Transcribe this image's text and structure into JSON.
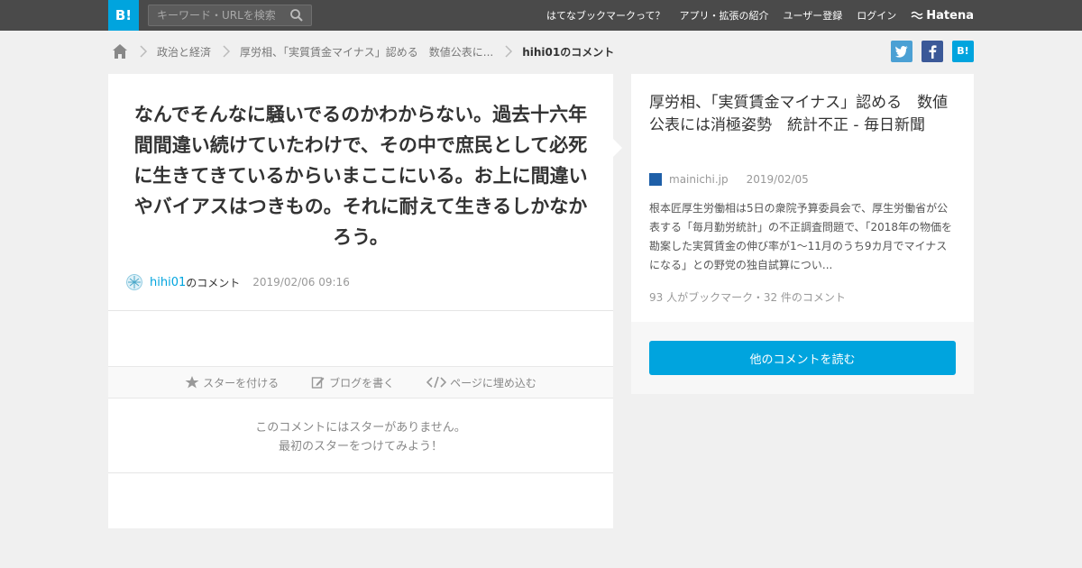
{
  "header": {
    "logo": "B!",
    "search_placeholder": "キーワード・URLを検索",
    "links": [
      "はてなブックマークって？",
      "アプリ・拡張の紹介",
      "ユーザー登録",
      "ログイン"
    ],
    "brand": "Hatena"
  },
  "breadcrumb": {
    "items": [
      "政治と経済",
      "厚労相、「実質賃金マイナス」認める　数値公表に...",
      "hihi01のコメント"
    ]
  },
  "share": {
    "twitter": "t",
    "facebook": "f",
    "hatena": "B!"
  },
  "comment": {
    "text": "なんでそんなに騒いでるのかわからない。過去十六年間間違い続けていたわけで、その中で庶民として必死に生きてきているからいまここにいる。お上に間違いやバイアスはつきもの。それに耐えて生きるしかなかろう。",
    "user": "hihi01",
    "suffix": "のコメント",
    "date": "2019/02/06 09:16",
    "actions": {
      "star": "スターを付ける",
      "blog": "ブログを書く",
      "embed": "ページに埋め込む"
    },
    "no_star_line1": "このコメントにはスターがありません。",
    "no_star_line2": "最初のスターをつけてみよう！"
  },
  "entry": {
    "title": "厚労相、「実質賃金マイナス」認める　数値公表には消極姿勢　統計不正 - 毎日新聞",
    "domain": "mainichi.jp",
    "date": "2019/02/05",
    "summary": "根本匠厚生労働相は5日の衆院予算委員会で、厚生労働省が公表する「毎月勤労統計」の不正調査問題で、「2018年の物価を勘案した実質賃金の伸び率が1～11月のうち9カ月でマイナスになる」との野党の独自試算につい...",
    "counts": "93 人がブックマーク・32 件のコメント",
    "read_more": "他のコメントを読む"
  },
  "colors": {
    "accent": "#00a4de",
    "topbar": "#4a4a4a",
    "background": "#f0f0f0"
  }
}
